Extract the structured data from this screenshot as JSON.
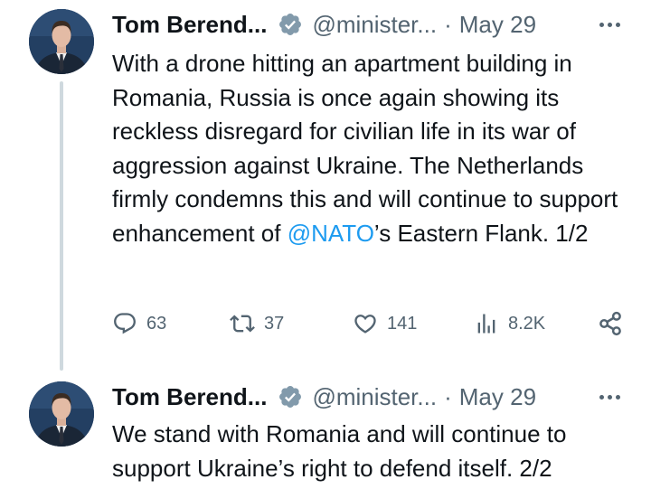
{
  "tweets": [
    {
      "author_name": "Tom Berend...",
      "handle": "@minister...",
      "separator": "·",
      "date": "May 29",
      "text_before_mention": "With a drone hitting an apartment building in Romania, Russia is once again showing its reckless disregard for civilian life in its war of aggression against Ukraine. The Netherlands firmly condemns this and will continue to support enhancement of ",
      "mention": "@NATO",
      "text_after_mention": "’s Eastern Flank. 1/2",
      "replies": "63",
      "reposts": "37",
      "likes": "141",
      "views": "8.2K"
    },
    {
      "author_name": "Tom Berend...",
      "handle": "@minister...",
      "separator": "·",
      "date": "May 29",
      "text": "We stand with Romania and will continue to support Ukraine’s right to defend itself. 2/2"
    }
  ],
  "icons": {
    "verified": "verified-badge-icon",
    "more": "more-icon",
    "reply": "reply-icon",
    "repost": "repost-icon",
    "like": "like-icon",
    "views": "views-icon",
    "share": "share-icon"
  },
  "colors": {
    "text": "#0f1419",
    "secondary": "#536471",
    "link": "#1d9bf0",
    "thread_line": "#cfd9de",
    "verified_badge": "#829aab"
  }
}
